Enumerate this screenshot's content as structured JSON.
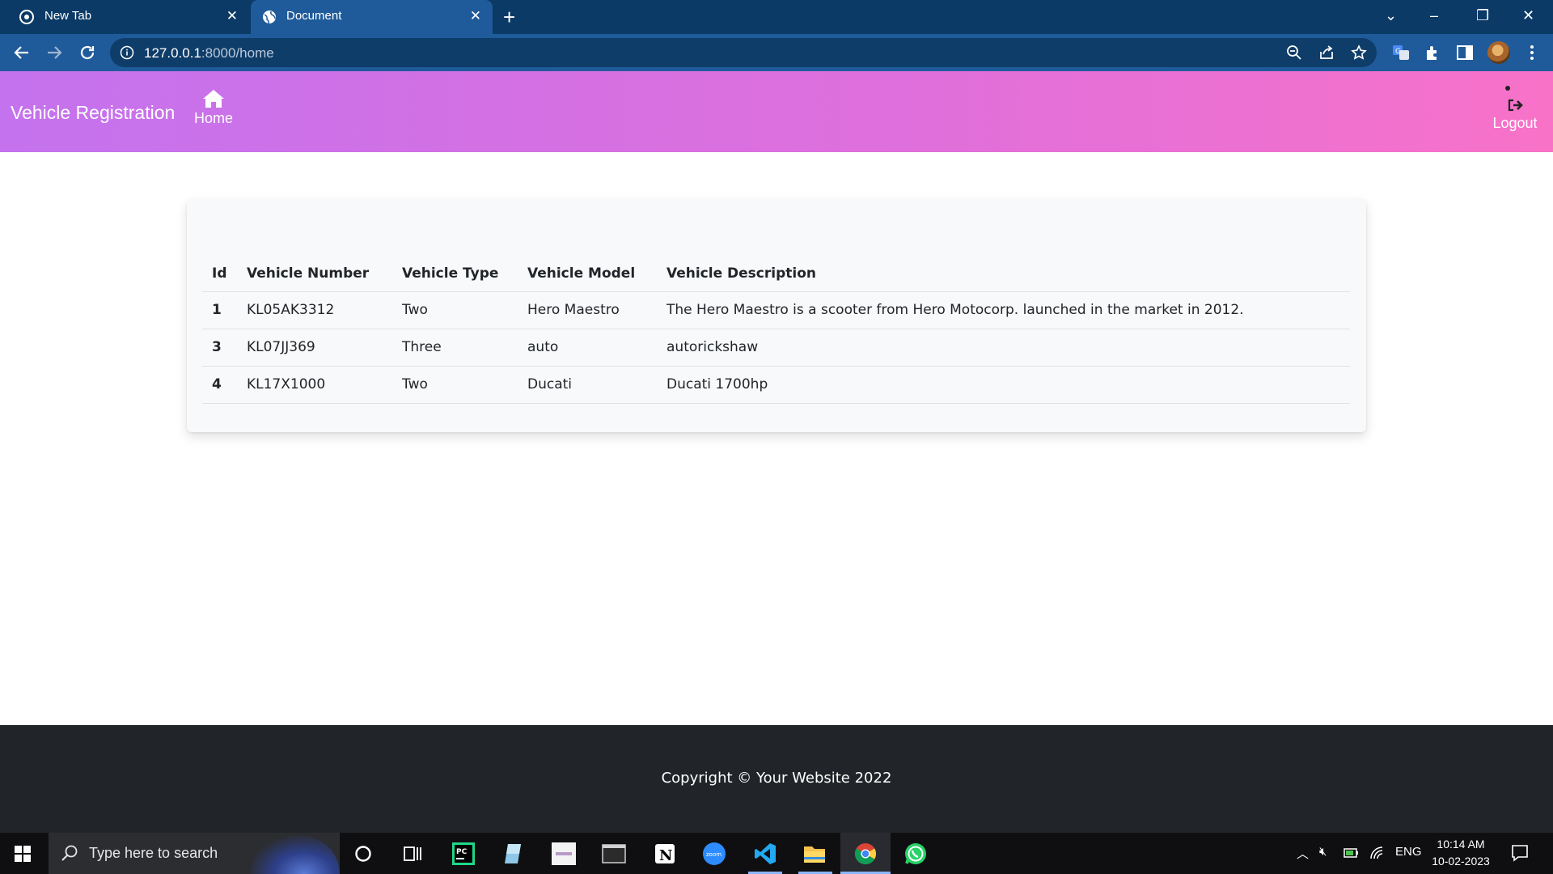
{
  "browser": {
    "tabs": [
      {
        "title": "New Tab",
        "active": false
      },
      {
        "title": "Document",
        "active": true
      }
    ],
    "url_host": "127.0.0.1",
    "url_path": ":8000/home"
  },
  "navbar": {
    "brand": "Vehicle Registration",
    "home_label": "Home",
    "logout_label": "Logout"
  },
  "table": {
    "headers": [
      "Id",
      "Vehicle Number",
      "Vehicle Type",
      "Vehicle Model",
      "Vehicle Description"
    ],
    "rows": [
      {
        "id": "1",
        "number": "KL05AK3312",
        "type": "Two",
        "model": "Hero Maestro",
        "description": "The Hero Maestro is a scooter from Hero Motocorp. launched in the market in 2012."
      },
      {
        "id": "3",
        "number": "KL07JJ369",
        "type": "Three",
        "model": "auto",
        "description": "autorickshaw"
      },
      {
        "id": "4",
        "number": "KL17X1000",
        "type": "Two",
        "model": "Ducati",
        "description": "Ducati 1700hp"
      }
    ]
  },
  "footer": {
    "copyright": "Copyright © Your Website 2022"
  },
  "taskbar": {
    "search_placeholder": "Type here to search",
    "language": "ENG",
    "time": "10:14 AM",
    "date": "10-02-2023",
    "apps": [
      "cortana-icon",
      "task-view-icon",
      "pycharm-icon",
      "app-icon",
      "app-icon",
      "terminal-icon",
      "notion-icon",
      "zoom-icon",
      "vscode-icon",
      "file-explorer-icon",
      "chrome-icon",
      "whatsapp-icon"
    ]
  },
  "colors": {
    "tabstrip": "#0b3a66",
    "toolbar": "#1f5b9a",
    "navbar_start": "#c472ee",
    "navbar_end": "#f872c8",
    "footer": "#212529"
  }
}
